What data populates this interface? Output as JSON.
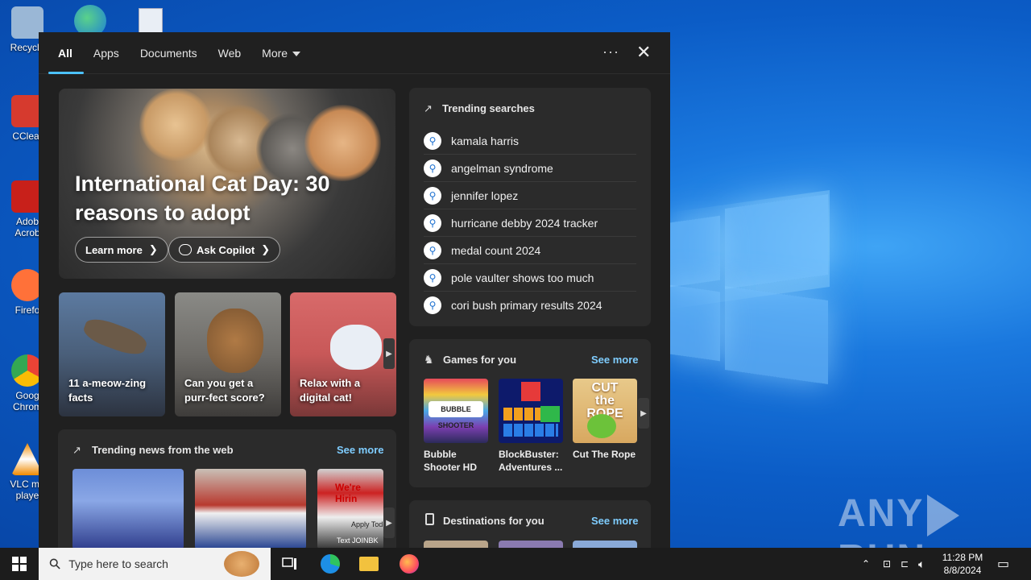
{
  "desktop": {
    "icons": [
      {
        "label": "Recycle",
        "color": "#9ab7d6"
      },
      {
        "label": "CClear",
        "color": "#d63a2e"
      },
      {
        "label": "Adob Acrob",
        "color": "#c8201a"
      },
      {
        "label": "Firefo",
        "color": "#ff7139"
      },
      {
        "label": "Goog Chrom",
        "color": "#34a853"
      },
      {
        "label": "VLC me playe",
        "color": "#f08a00"
      }
    ],
    "watermark": "ANY RUN"
  },
  "search_panel": {
    "tabs": [
      {
        "label": "All",
        "active": true
      },
      {
        "label": "Apps",
        "active": false
      },
      {
        "label": "Documents",
        "active": false
      },
      {
        "label": "Web",
        "active": false
      },
      {
        "label": "More",
        "active": false
      }
    ],
    "more_options_icon": "ellipsis-icon",
    "close_icon": "close-icon",
    "hero": {
      "title": "International Cat Day: 30 reasons to adopt",
      "learn_more": "Learn more",
      "ask_copilot": "Ask Copilot"
    },
    "cards": [
      {
        "label": "11 a-meow-zing facts"
      },
      {
        "label": "Can you get a purr-fect score?"
      },
      {
        "label": "Relax with a digital cat!"
      }
    ],
    "trending_searches": {
      "title": "Trending searches",
      "items": [
        "kamala harris",
        "angelman syndrome",
        "jennifer lopez",
        "hurricane debby 2024 tracker",
        "medal count 2024",
        "pole vaulter shows too much",
        "cori bush primary results 2024"
      ]
    },
    "games": {
      "title": "Games for you",
      "see_more": "See more",
      "items": [
        {
          "name": "Bubble Shooter HD",
          "thumb_text": "BUBBLE SHOOTER"
        },
        {
          "name": "BlockBuster: Adventures ...",
          "thumb_text": ""
        },
        {
          "name": "Cut The Rope",
          "thumb_text": "CUT the ROPE"
        }
      ]
    },
    "trending_news": {
      "title": "Trending news from the web",
      "see_more": "See more",
      "thumb_texts": [
        "We're Hirin",
        "Apply Tod",
        "Text JOINBK"
      ]
    },
    "destinations": {
      "title": "Destinations for you",
      "see_more": "See more"
    }
  },
  "taskbar": {
    "search_placeholder": "Type here to search",
    "time": "11:28 PM",
    "date": "8/8/2024"
  }
}
